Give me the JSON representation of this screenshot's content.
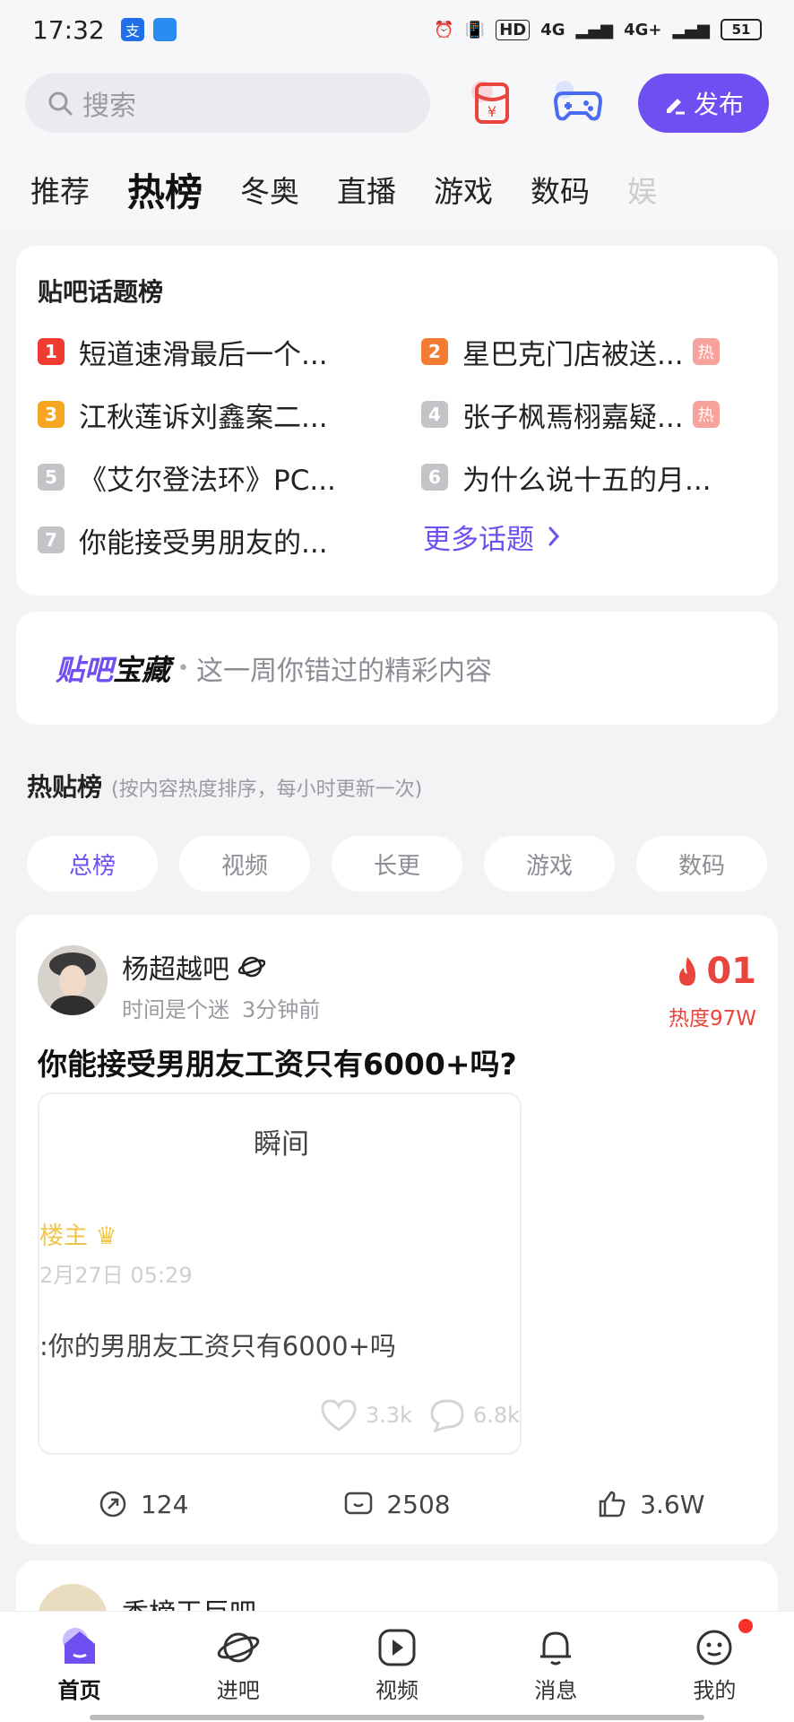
{
  "status_bar": {
    "time": "17:32",
    "network1": "4G",
    "network2": "4G+",
    "hd": "HD",
    "battery": "51"
  },
  "search": {
    "placeholder": "搜索"
  },
  "publish_label": "发布",
  "tabs": [
    {
      "label": "推荐"
    },
    {
      "label": "热榜"
    },
    {
      "label": "冬奥"
    },
    {
      "label": "直播"
    },
    {
      "label": "游戏"
    },
    {
      "label": "数码"
    },
    {
      "label": "娱"
    }
  ],
  "topic_board": {
    "title": "贴吧话题榜",
    "items": [
      {
        "rank": "1",
        "text": "短道速滑最后一个...",
        "hot": "",
        "color": "#f03b33"
      },
      {
        "rank": "2",
        "text": "星巴克门店被送...",
        "hot": "热",
        "color": "#f37c34"
      },
      {
        "rank": "3",
        "text": "江秋莲诉刘鑫案二...",
        "hot": "",
        "color": "#f6a623"
      },
      {
        "rank": "4",
        "text": "张子枫焉栩嘉疑...",
        "hot": "热",
        "color": "#c4c4c8"
      },
      {
        "rank": "5",
        "text": "《艾尔登法环》PC...",
        "hot": "",
        "color": "#c4c4c8"
      },
      {
        "rank": "6",
        "text": "为什么说十五的月...",
        "hot": "",
        "color": "#c4c4c8"
      },
      {
        "rank": "7",
        "text": "你能接受男朋友的...",
        "hot": "",
        "color": "#c4c4c8"
      }
    ],
    "more": "更多话题"
  },
  "treasure": {
    "brand_part1": "贴吧",
    "brand_part2": "宝藏",
    "desc": "这一周你错过的精彩内容"
  },
  "hot_posts": {
    "title": "热贴榜",
    "subtitle": "(按内容热度排序，每小时更新一次)",
    "filters": [
      "总榜",
      "视频",
      "长更",
      "游戏",
      "数码"
    ]
  },
  "post": {
    "forum": "杨超越吧",
    "user": "时间是个迷",
    "time": "3分钟前",
    "rank": "01",
    "heat": "热度97W",
    "title": "你能接受男朋友工资只有6000+吗?",
    "media": {
      "header": "瞬间",
      "owner": "楼主",
      "date": "2月27日 05:29",
      "text": ":你的男朋友工资只有6000+吗",
      "likes": "3.3k",
      "comments": "6.8k"
    },
    "shares": "124",
    "comments": "2508",
    "likes": "3.6W"
  },
  "post2": {
    "forum": "香榜王巨吧"
  },
  "bottom_nav": [
    {
      "label": "首页"
    },
    {
      "label": "进吧"
    },
    {
      "label": "视频"
    },
    {
      "label": "消息"
    },
    {
      "label": "我的"
    }
  ]
}
